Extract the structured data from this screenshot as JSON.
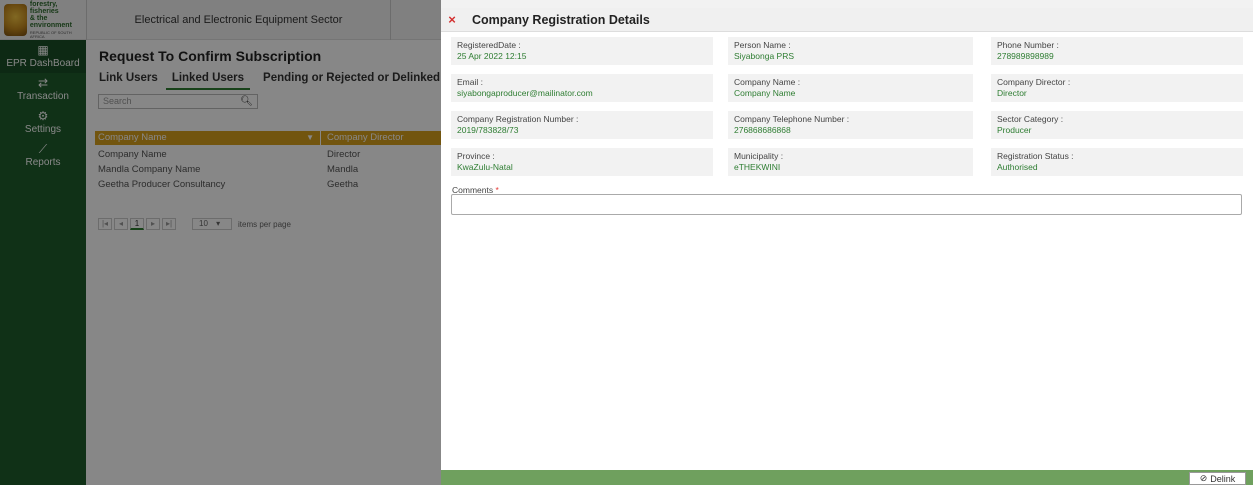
{
  "header": {
    "logo_line1": "forestry, fisheries",
    "logo_line2": "& the environment",
    "logo_line3": "REPUBLIC OF SOUTH AFRICA",
    "sector": "Electrical and Electronic Equipment Sector"
  },
  "sidebar": {
    "items": [
      {
        "label": "EPR DashBoard",
        "icon": "dashboard-icon",
        "glyph": "▦"
      },
      {
        "label": "Transaction",
        "icon": "transfer-icon",
        "glyph": "⇄"
      },
      {
        "label": "Settings",
        "icon": "gears-icon",
        "glyph": "⚙"
      },
      {
        "label": "Reports",
        "icon": "chart-icon",
        "glyph": "⟋"
      }
    ]
  },
  "main": {
    "title": "Request To Confirm Subscription",
    "tabs": [
      "Link Users",
      "Linked Users",
      "Pending or Rejected or Delinked Use"
    ],
    "active_tab": 1,
    "search_placeholder": "Search",
    "search_icon": "search-icon",
    "grid": {
      "columns": [
        "Company Name",
        "Company Director"
      ],
      "rows": [
        [
          "Company Name",
          "Director"
        ],
        [
          "Mandla Company Name",
          "Mandla"
        ],
        [
          "Geetha Producer Consultancy",
          "Geetha"
        ]
      ]
    },
    "pager": {
      "first": "|◂",
      "prev": "◂",
      "current": "1",
      "next": "▸",
      "last": "▸|",
      "page_size": "10",
      "page_size_arrow": "▾",
      "items_label": "items per page"
    }
  },
  "dialog": {
    "title": "Company Registration Details",
    "close_glyph": "×",
    "fields": [
      {
        "label": "RegisteredDate :",
        "value": "25 Apr 2022 12:15"
      },
      {
        "label": "Person Name :",
        "value": "Siyabonga PRS"
      },
      {
        "label": "Phone Number :",
        "value": "278989898989"
      },
      {
        "label": "Email :",
        "value": "siyabongaproducer@mailinator.com"
      },
      {
        "label": "Company Name :",
        "value": "Company Name"
      },
      {
        "label": "Company Director :",
        "value": "Director"
      },
      {
        "label": "Company Registration Number :",
        "value": "2019/783828/73"
      },
      {
        "label": "Company Telephone Number :",
        "value": "276868686868"
      },
      {
        "label": "Sector Category :",
        "value": "Producer"
      },
      {
        "label": "Province :",
        "value": "KwaZulu-Natal"
      },
      {
        "label": "Municipality :",
        "value": "eTHEKWINI"
      },
      {
        "label": "Registration Status :",
        "value": "Authorised"
      }
    ],
    "comments_label": "Comments",
    "comments_required": "*",
    "comments_value": "",
    "delink_label": "Delink",
    "delink_glyph": "⊘"
  },
  "colors": {
    "sidebar": "#1f5e2d",
    "accent": "#2e7d32",
    "grid_header": "#d8a11e",
    "footer": "#6fa05e",
    "close": "#d32f2f"
  }
}
